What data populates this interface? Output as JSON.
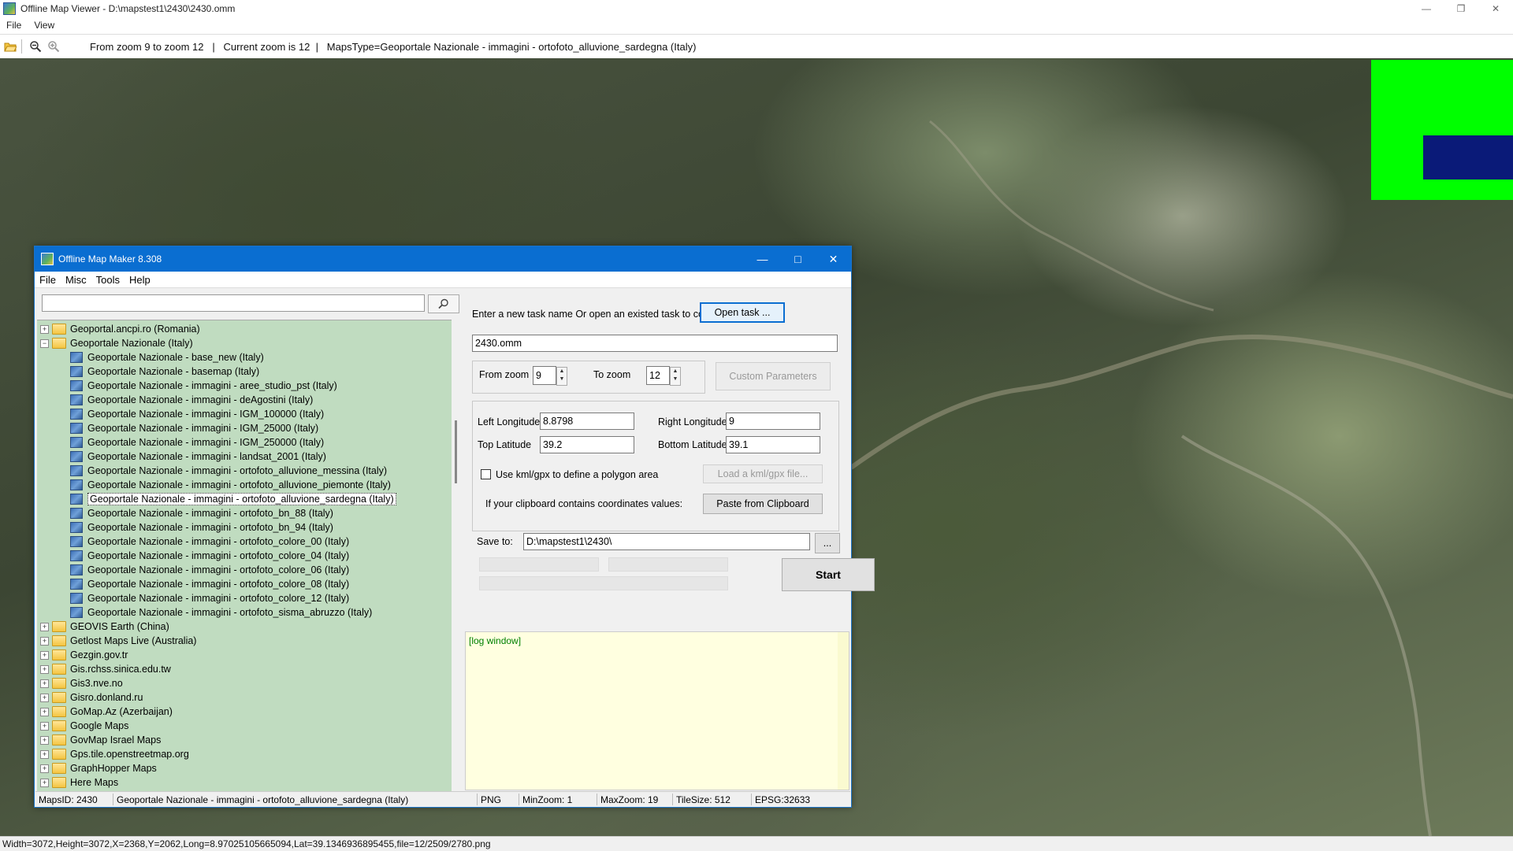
{
  "app": {
    "title": "Offline Map Viewer - D:\\mapstest1\\2430\\2430.omm",
    "menu": [
      "File",
      "View"
    ],
    "toolbar_info": "From zoom 9 to zoom 12   |   Current zoom is 12  |   MapsType=Geoportale Nazionale - immagini - ortofoto_alluvione_sardegna (Italy)",
    "status": "Width=3072,Height=3072,X=2368,Y=2062,Long=8.97025105665094,Lat=39.1346936895455,file=12/2509/2780.png",
    "icons": [
      "app-logo-icon",
      "open-folder-icon",
      "zoom-out-icon",
      "zoom-in-icon",
      "minimize-icon",
      "restore-icon",
      "close-icon"
    ],
    "overlay_colors": {
      "green": "#00ff00",
      "blue": "#0a1a78"
    }
  },
  "dialog": {
    "title": "Offline Map Maker 8.308",
    "menu": [
      "File",
      "Misc",
      "Tools",
      "Help"
    ],
    "search_value": "",
    "tree": [
      {
        "label": "Geoportal.ancpi.ro (Romania)",
        "kind": "folder",
        "expander": "+",
        "level": 0
      },
      {
        "label": "Geoportale Nazionale (Italy)",
        "kind": "folder-open",
        "expander": "−",
        "level": 0
      },
      {
        "label": "Geoportale Nazionale - base_new (Italy)",
        "kind": "map",
        "level": 1
      },
      {
        "label": "Geoportale Nazionale - basemap (Italy)",
        "kind": "map",
        "level": 1
      },
      {
        "label": "Geoportale Nazionale - immagini - aree_studio_pst (Italy)",
        "kind": "map",
        "level": 1
      },
      {
        "label": "Geoportale Nazionale - immagini - deAgostini (Italy)",
        "kind": "map",
        "level": 1
      },
      {
        "label": "Geoportale Nazionale - immagini - IGM_100000 (Italy)",
        "kind": "map",
        "level": 1
      },
      {
        "label": "Geoportale Nazionale - immagini - IGM_25000 (Italy)",
        "kind": "map",
        "level": 1
      },
      {
        "label": "Geoportale Nazionale - immagini - IGM_250000 (Italy)",
        "kind": "map",
        "level": 1
      },
      {
        "label": "Geoportale Nazionale - immagini - landsat_2001 (Italy)",
        "kind": "map",
        "level": 1
      },
      {
        "label": "Geoportale Nazionale - immagini - ortofoto_alluvione_messina (Italy)",
        "kind": "map",
        "level": 1
      },
      {
        "label": "Geoportale Nazionale - immagini - ortofoto_alluvione_piemonte (Italy)",
        "kind": "map",
        "level": 1
      },
      {
        "label": "Geoportale Nazionale - immagini - ortofoto_alluvione_sardegna (Italy)",
        "kind": "map",
        "level": 1,
        "selected": true
      },
      {
        "label": "Geoportale Nazionale - immagini - ortofoto_bn_88 (Italy)",
        "kind": "map",
        "level": 1
      },
      {
        "label": "Geoportale Nazionale - immagini - ortofoto_bn_94 (Italy)",
        "kind": "map",
        "level": 1
      },
      {
        "label": "Geoportale Nazionale - immagini - ortofoto_colore_00 (Italy)",
        "kind": "map",
        "level": 1
      },
      {
        "label": "Geoportale Nazionale - immagini - ortofoto_colore_04 (Italy)",
        "kind": "map",
        "level": 1
      },
      {
        "label": "Geoportale Nazionale - immagini - ortofoto_colore_06 (Italy)",
        "kind": "map",
        "level": 1
      },
      {
        "label": "Geoportale Nazionale - immagini - ortofoto_colore_08 (Italy)",
        "kind": "map",
        "level": 1
      },
      {
        "label": "Geoportale Nazionale - immagini - ortofoto_colore_12 (Italy)",
        "kind": "map",
        "level": 1
      },
      {
        "label": "Geoportale Nazionale - immagini - ortofoto_sisma_abruzzo (Italy)",
        "kind": "map",
        "level": 1
      },
      {
        "label": "GEOVIS Earth (China)",
        "kind": "folder",
        "expander": "+",
        "level": 0
      },
      {
        "label": "Getlost Maps Live (Australia)",
        "kind": "folder",
        "expander": "+",
        "level": 0
      },
      {
        "label": "Gezgin.gov.tr",
        "kind": "folder",
        "expander": "+",
        "level": 0
      },
      {
        "label": "Gis.rchss.sinica.edu.tw",
        "kind": "folder",
        "expander": "+",
        "level": 0
      },
      {
        "label": "Gis3.nve.no",
        "kind": "folder",
        "expander": "+",
        "level": 0
      },
      {
        "label": "Gisro.donland.ru",
        "kind": "folder",
        "expander": "+",
        "level": 0
      },
      {
        "label": "GoMap.Az (Azerbaijan)",
        "kind": "folder",
        "expander": "+",
        "level": 0
      },
      {
        "label": "Google Maps",
        "kind": "folder",
        "expander": "+",
        "level": 0
      },
      {
        "label": "GovMap Israel Maps",
        "kind": "folder",
        "expander": "+",
        "level": 0
      },
      {
        "label": "Gps.tile.openstreetmap.org",
        "kind": "folder",
        "expander": "+",
        "level": 0
      },
      {
        "label": "GraphHopper Maps",
        "kind": "folder",
        "expander": "+",
        "level": 0
      },
      {
        "label": "Here Maps",
        "kind": "folder",
        "expander": "+",
        "level": 0
      }
    ],
    "task_prompt": "Enter a new task name Or open an existed task to continue:",
    "open_task_label": "Open task ...",
    "task_name": "2430.omm",
    "from_zoom_label": "From zoom",
    "from_zoom": "9",
    "to_zoom_label": "To zoom",
    "to_zoom": "12",
    "custom_params_label": "Custom Parameters",
    "left_lon_label": "Left Longitude",
    "left_lon": "8.8798",
    "right_lon_label": "Right Longitude",
    "right_lon": "9",
    "top_lat_label": "Top Latitude",
    "top_lat": "39.2",
    "bottom_lat_label": "Bottom Latitude",
    "bottom_lat": "39.1",
    "kml_label": "Use kml/gpx to define a polygon area",
    "load_kml_label": "Load a kml/gpx file...",
    "clipboard_prompt": "If your clipboard contains coordinates values:",
    "paste_label": "Paste from Clipboard",
    "save_to_label": "Save to:",
    "save_to": "D:\\mapstest1\\2430\\",
    "browse_label": "...",
    "start_label": "Start",
    "log_text": "[log window]",
    "status": {
      "maps_id": "MapsID: 2430",
      "maps_name": "Geoportale Nazionale - immagini - ortofoto_alluvione_sardegna (Italy)",
      "format": "PNG",
      "min_zoom": "MinZoom: 1",
      "max_zoom": "MaxZoom: 19",
      "tile_size": "TileSize: 512",
      "epsg": "EPSG:32633"
    }
  }
}
